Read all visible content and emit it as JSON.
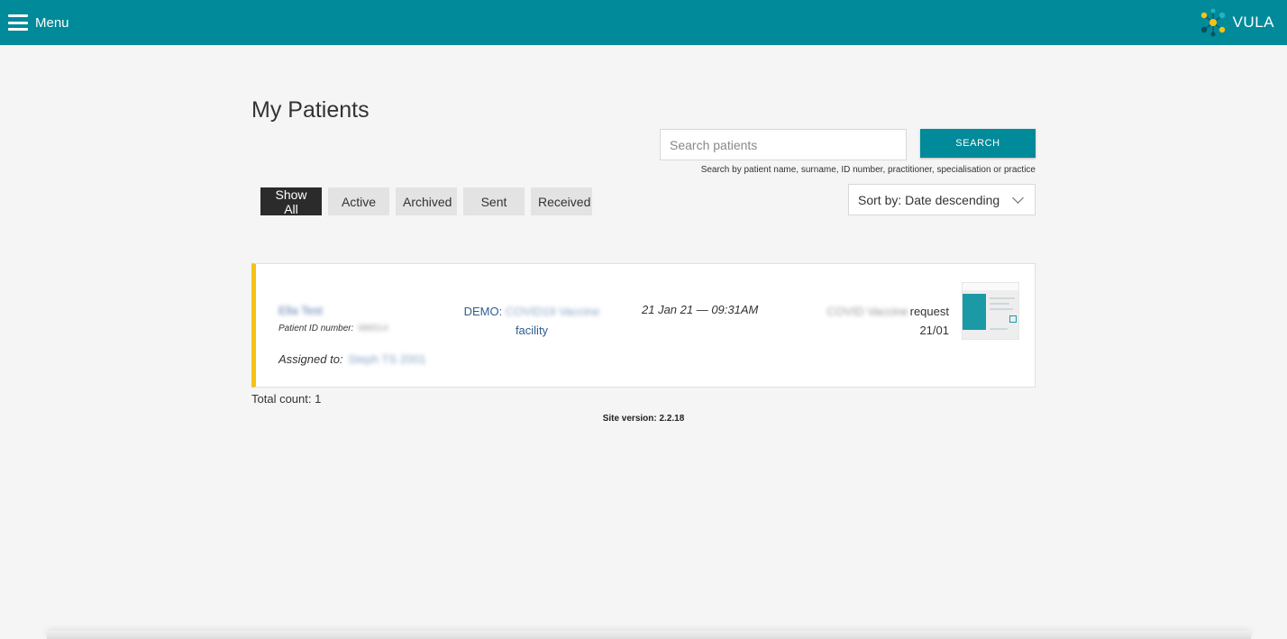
{
  "topbar": {
    "menu_label": "Menu",
    "brand_name": "VULA",
    "background": "#018a99"
  },
  "page": {
    "title": "My Patients"
  },
  "search": {
    "placeholder": "Search patients",
    "value": "",
    "button_label": "SEARCH",
    "hint": "Search by patient name, surname, ID number, practitioner, specialisation or practice"
  },
  "filters": [
    {
      "label": "Show All",
      "active": true
    },
    {
      "label": "Active",
      "active": false
    },
    {
      "label": "Archived",
      "active": false
    },
    {
      "label": "Sent",
      "active": false
    },
    {
      "label": "Received",
      "active": false
    }
  ],
  "sort": {
    "label": "Sort by: Date descending"
  },
  "patients": [
    {
      "name": "Ella Test",
      "id_label": "Patient ID number:",
      "id_value": "986514",
      "assigned_label": "Assigned to:",
      "assigned_value": "Steph TS 2001",
      "facility_prefix": "DEMO:",
      "facility_name": "COVID19 Vaccine",
      "facility_suffix": "facility",
      "datetime": "21 Jan 21 — 09:31AM",
      "request_type": "COVID Vaccine",
      "request_word": "request",
      "request_date": "21/01",
      "flag_color": "#f5c314"
    }
  ],
  "total": "Total count: 1",
  "version": "Site version: 2.2.18"
}
